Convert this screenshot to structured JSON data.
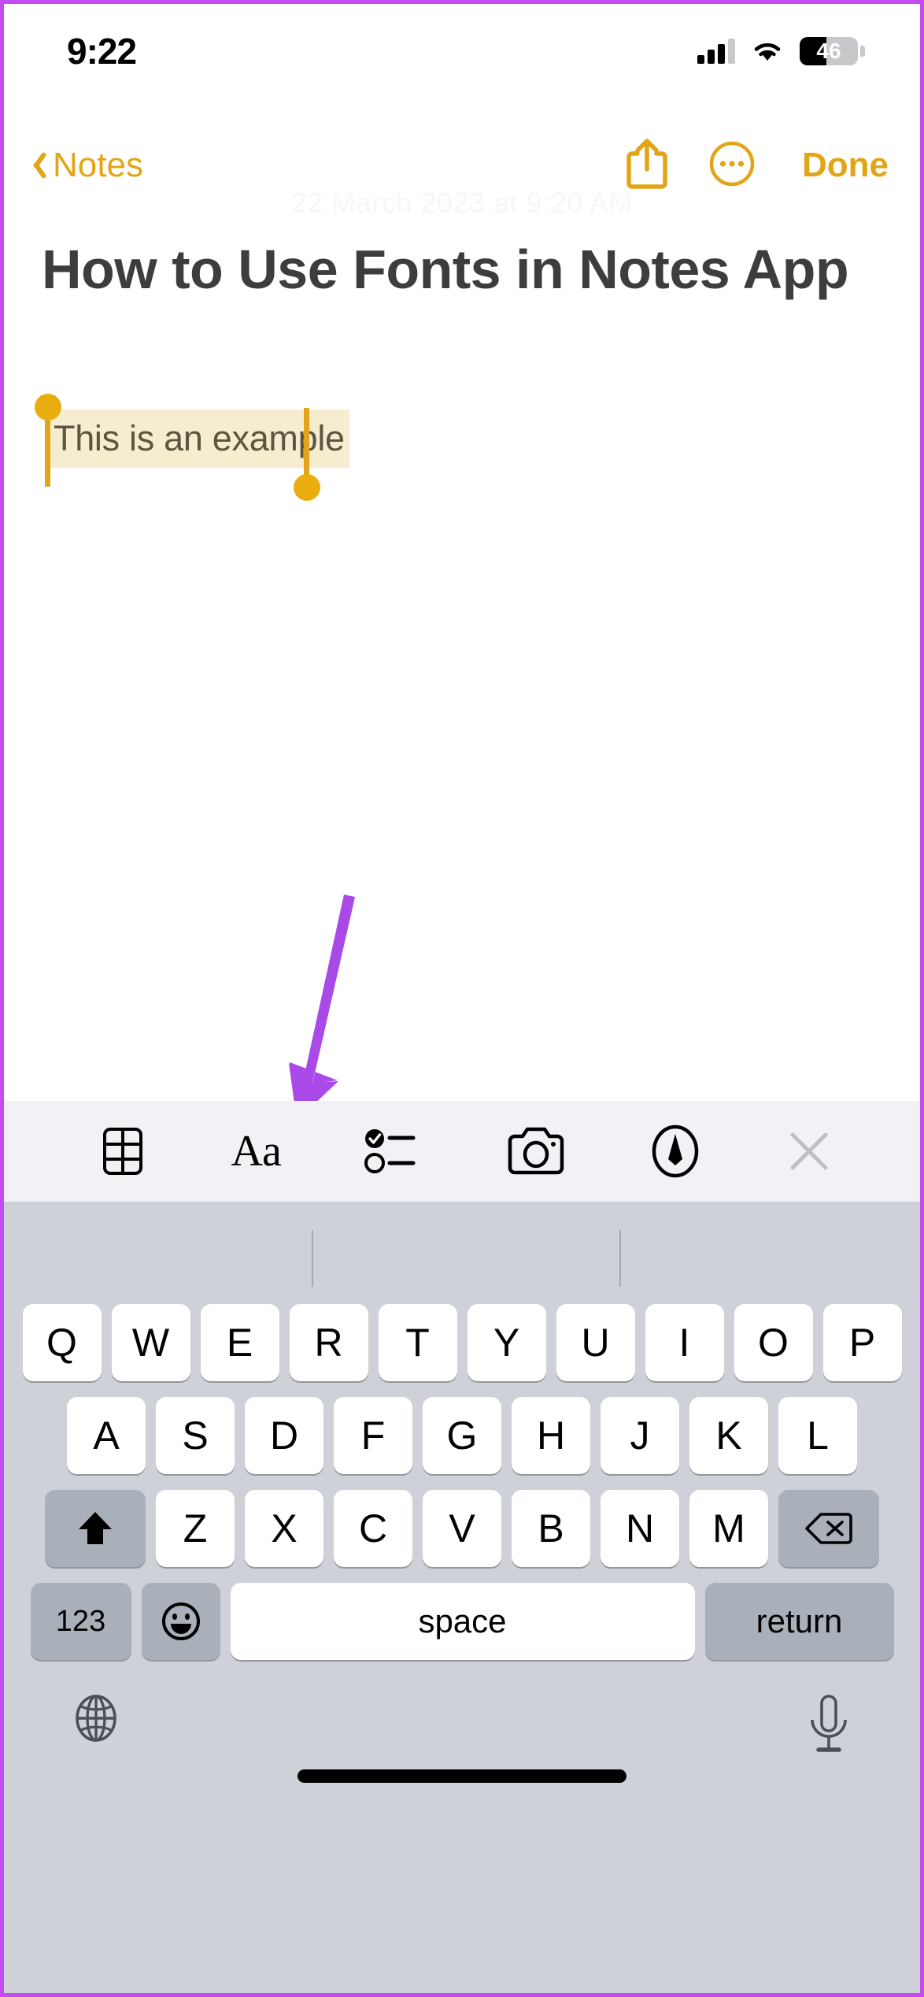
{
  "status_bar": {
    "time": "9:22",
    "signal_icon": "cellular-signal-icon",
    "wifi_icon": "wifi-icon",
    "battery_percent": "46",
    "battery_level": 46
  },
  "nav_bar": {
    "back_label": "Notes",
    "back_icon": "chevron-left-icon",
    "share_icon": "share-icon",
    "more_icon": "ellipsis-circle-icon",
    "done_label": "Done"
  },
  "note": {
    "timestamp": "22 March 2023 at 9:20 AM",
    "title": "How to Use Fonts in Notes App",
    "selected_text": "This is an example",
    "selection_highlight_color": "#f6ecd0",
    "selection_handle_color": "#e2a517"
  },
  "annotation": {
    "arrow_color": "#a94ae8",
    "points_to": "format-aa-button"
  },
  "format_toolbar": {
    "background": "#f2f1f6",
    "buttons": [
      {
        "name": "table-button",
        "icon": "table-icon",
        "label": ""
      },
      {
        "name": "format-aa-button",
        "icon": "aa-icon",
        "label": "Aa"
      },
      {
        "name": "checklist-button",
        "icon": "checklist-icon",
        "label": ""
      },
      {
        "name": "camera-button",
        "icon": "camera-icon",
        "label": ""
      },
      {
        "name": "markup-button",
        "icon": "markup-pen-icon",
        "label": ""
      },
      {
        "name": "close-toolbar-button",
        "icon": "close-x-icon",
        "label": ""
      }
    ]
  },
  "keyboard": {
    "background": "#cfd1d8",
    "predictive_bar": {
      "suggestions": [
        "",
        "",
        ""
      ]
    },
    "row1": [
      "Q",
      "W",
      "E",
      "R",
      "T",
      "Y",
      "U",
      "I",
      "O",
      "P"
    ],
    "row2": [
      "A",
      "S",
      "D",
      "F",
      "G",
      "H",
      "J",
      "K",
      "L"
    ],
    "row3": [
      "Z",
      "X",
      "C",
      "V",
      "B",
      "N",
      "M"
    ],
    "shift_icon": "shift-arrow-icon",
    "delete_icon": "delete-backward-icon",
    "numbers_label": "123",
    "emoji_icon": "emoji-smiley-icon",
    "space_label": "space",
    "return_label": "return",
    "globe_icon": "globe-icon",
    "mic_icon": "microphone-icon"
  },
  "colors": {
    "accent_gold": "#e2a517",
    "annotation_purple": "#a94ae8",
    "note_text": "#3d3d3f",
    "device_border": "#c44cf0"
  }
}
